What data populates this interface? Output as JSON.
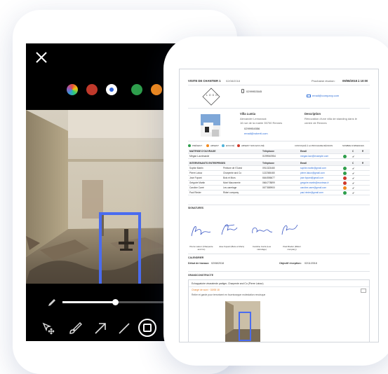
{
  "editor": {
    "colors": [
      "#7a7a7a",
      "#d0392b",
      "#ffffff",
      "#2e9e4c",
      "#f28a1e"
    ],
    "tools": [
      "pencil-icon",
      "move-icon",
      "brush-icon",
      "arrow-icon",
      "line-icon",
      "rectangle-icon"
    ],
    "slider_level": 0.5
  },
  "report": {
    "title": "VISITE DE CHANTIER 1",
    "date": "02/08/2018",
    "next_label": "Prochaine réunion:",
    "next_date": "09/08/2018 à 10:00",
    "logo_text": "L O G O",
    "company_phone": "0299953545",
    "company_email": "email@company.com",
    "site_name": "Villa Lumia",
    "site_address_1": "Alexander Lemonack",
    "site_address_2": "16 rue de la mairie 35700 Rennes",
    "site_phone": "0299954556",
    "site_email": "email@roberti.com",
    "desc_label": "Description",
    "desc_text_1": "Rénovation d'une villa de standing dans le",
    "desc_text_2": "centre de Rennes",
    "legend": [
      "PRÉSENT",
      "ABSENT",
      "EXCUSÉ",
      "ABSENT NON EXCUSÉ"
    ],
    "legend_right": [
      "CONVOQUÉ À LA PROCHAINE RÉUNION",
      "NOMBRE D'ABSENCES"
    ],
    "moa_header": [
      "MAÎTRISE D'OUVRAGE",
      "Téléphone",
      "Email",
      "C",
      "R"
    ],
    "moa_rows": [
      {
        "name": "Mégan Lacrimarde",
        "phone": "0199940954",
        "email": "megan.lacr@example.com"
      }
    ],
    "int_header": [
      "INTERVENANTS ENTREPRISES",
      "Téléphone",
      "Email",
      "C",
      "R"
    ],
    "int_rows": [
      {
        "name": "Sophie Martin",
        "company": "Peinture de l'Ouest",
        "phone": "0911323465",
        "email": "sophie.martin@gmail.com",
        "status": "green"
      },
      {
        "name": "Pierre Latour",
        "company": "Charpente and Co",
        "phone": "1132365465",
        "email": "pierre.latour@gmail.com",
        "status": "green"
      },
      {
        "name": "Jose Fopant",
        "company": "Bois et Murs",
        "phone": "6644556677",
        "email": "jose.fopant@gmail.com",
        "status": "red"
      },
      {
        "name": "Grégoire Martin",
        "company": "Mont Maconnerie",
        "phone": "0664778899",
        "email": "gregoire.martin@montmac.fr",
        "status": "red"
      },
      {
        "name": "Caroline Carré",
        "company": "Les carrelage",
        "phone": "0677889900",
        "email": "caroline.carre@gmail.com",
        "status": "orange"
      },
      {
        "name": "Paul Rieder",
        "company": "Rideri company",
        "phone": "",
        "email": "paul.rieder@gmail.com",
        "status": "green"
      }
    ],
    "signatures_label": "SIGNATURES",
    "signatures": [
      {
        "name": "Pierre Latour (Charpente and Co)"
      },
      {
        "name": "Jose Fopant (Bois et Murs)"
      },
      {
        "name": "Caroline Carré (Les carrelage)"
      },
      {
        "name": "Paul Rieder (Rideri company)"
      }
    ],
    "calendar_label": "CALENDRIER",
    "start_label": "Début de travaux:",
    "start_date": "02/08/2018",
    "goal_label": "Objectif réception:",
    "goal_date": "02/11/2018",
    "section_label": "GRANDCONSTRUCTE",
    "item_title": "Echappatoire vinaraterde partiger, Charpente and Co (Pierre Latour)",
    "item_tag": "Chargé de suivi · 02/08 18",
    "item_text": "Relier et garde pour terrorisent en fournisseppe molestation renoisque"
  }
}
